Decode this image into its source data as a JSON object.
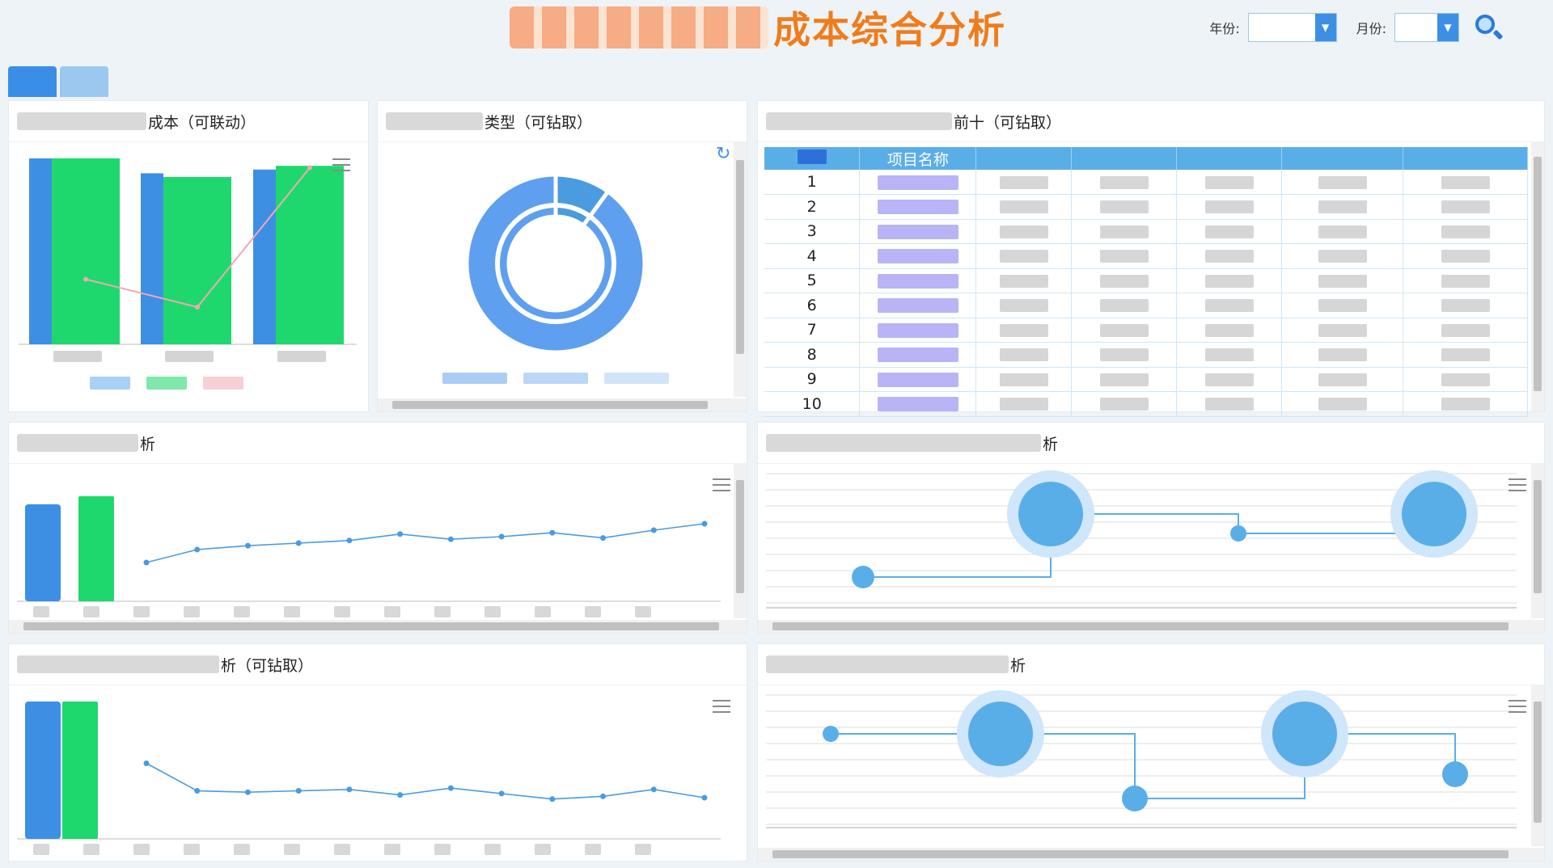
{
  "header": {
    "title": "成本综合分析",
    "year_label": "年份:",
    "year_value": "",
    "month_label": "月份:",
    "month_value": ""
  },
  "tabs": [
    {
      "label": ""
    },
    {
      "label": ""
    }
  ],
  "panels": {
    "cost_linkage": {
      "title": "成本（可联动）"
    },
    "type_drill": {
      "title": "类型（可钻取）"
    },
    "top_ten": {
      "title": "前十（可钻取）"
    },
    "mid_left": {
      "title": "析"
    },
    "mid_right": {
      "title": "析"
    },
    "bottom_left": {
      "title": "析（可钻取）"
    },
    "bottom_right": {
      "title": "析"
    }
  },
  "table": {
    "headers": [
      "",
      "项目名称",
      "",
      "",
      "",
      "",
      ""
    ],
    "rows": [
      {
        "rank": "1"
      },
      {
        "rank": "2"
      },
      {
        "rank": "3"
      },
      {
        "rank": "4"
      },
      {
        "rank": "5"
      },
      {
        "rank": "6"
      },
      {
        "rank": "7"
      },
      {
        "rank": "8"
      },
      {
        "rank": "9"
      },
      {
        "rank": "10"
      }
    ]
  },
  "colors": {
    "title": "#f07c1b",
    "blue": "#3d8fe4",
    "green": "#1ed86e",
    "line": "#4a9be0",
    "pink": "#f2a8b0",
    "bubble": "#5aaee8"
  },
  "icons": {
    "search": "search-icon",
    "menu": "menu-icon",
    "dropdown": "chevron-down-icon",
    "refresh": "refresh-icon"
  },
  "chart_data": [
    {
      "type": "bar",
      "categories": [
        "",
        "",
        ""
      ],
      "series": [
        {
          "values": [
            100,
            92,
            94
          ]
        },
        {
          "values": [
            100,
            90,
            96
          ]
        },
        {
          "values": [
            35,
            20,
            95
          ]
        }
      ],
      "title": ""
    },
    {
      "type": "pie",
      "values": [
        10,
        90
      ],
      "title": ""
    },
    {
      "type": "line",
      "categories": [
        "",
        "",
        "",
        "",
        "",
        "",
        "",
        "",
        "",
        "",
        "",
        ""
      ],
      "series": [
        {
          "values": [
            30,
            40,
            43,
            45,
            47,
            52,
            48,
            50,
            53,
            49,
            55,
            60
          ]
        }
      ],
      "title": ""
    },
    {
      "type": "scatter",
      "title": ""
    },
    {
      "type": "line",
      "categories": [
        "",
        "",
        "",
        "",
        "",
        "",
        "",
        "",
        "",
        "",
        "",
        ""
      ],
      "series": [
        {
          "values": [
            55,
            35,
            34,
            35,
            36,
            32,
            37,
            33,
            29,
            31,
            36,
            30
          ]
        }
      ],
      "title": ""
    },
    {
      "type": "scatter",
      "title": ""
    }
  ]
}
